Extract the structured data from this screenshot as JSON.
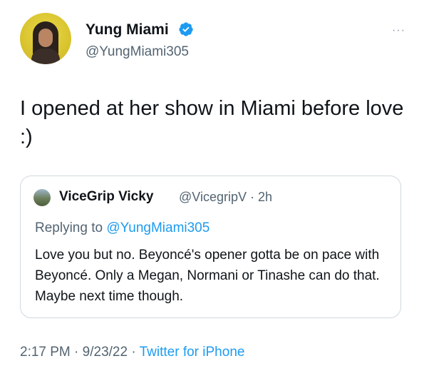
{
  "author": {
    "display_name": "Yung Miami",
    "handle": "@YungMiami305"
  },
  "more_menu": "···",
  "tweet": {
    "text": "I opened at her show in Miami before love :)"
  },
  "quoted_tweet": {
    "display_name": "ViceGrip Vicky",
    "handle": "@VicegripV",
    "separator": "·",
    "time": "2h",
    "replying_prefix": "Replying to",
    "replying_to": "@YungMiami305",
    "text": "Love you but no. Beyoncé's opener gotta be on pace with Beyoncé. Only a Megan, Normani or Tinashe can do that. Maybe next time though."
  },
  "footer": {
    "time": "2:17 PM",
    "separator": "·",
    "date": "9/23/22",
    "source": "Twitter for iPhone"
  },
  "colors": {
    "link": "#1d9bf0",
    "secondary_text": "#536471",
    "primary_text": "#0f1419",
    "border": "#cfd9de"
  },
  "icons": {
    "verified": "verified-badge-icon",
    "more": "more-horizontal-icon"
  }
}
